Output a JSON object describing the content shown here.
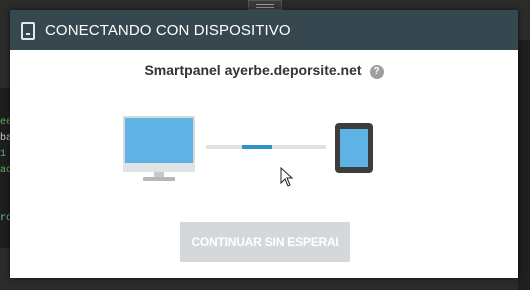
{
  "background": {
    "code_fragments": [
      "ee",
      "ba",
      "1",
      "ac",
      "ro"
    ]
  },
  "dialog": {
    "title": "CONECTANDO CON DISPOSITIVO",
    "title_icon": "tablet-icon",
    "site_name": "Smartpanel ayerbe.deporsite.net",
    "help_icon": "help-icon",
    "help_glyph": "?",
    "devices": [
      "monitor-icon",
      "tablet-icon"
    ],
    "connection_progress": 0.3,
    "continue_button_label": "CONTINUAR SIN ESPERAI",
    "continue_button_enabled": false
  },
  "colors": {
    "header_bg": "#37474f",
    "accent_blue": "#2f93c9",
    "device_screen": "#5eb3e4",
    "button_disabled": "#d5d8da"
  }
}
